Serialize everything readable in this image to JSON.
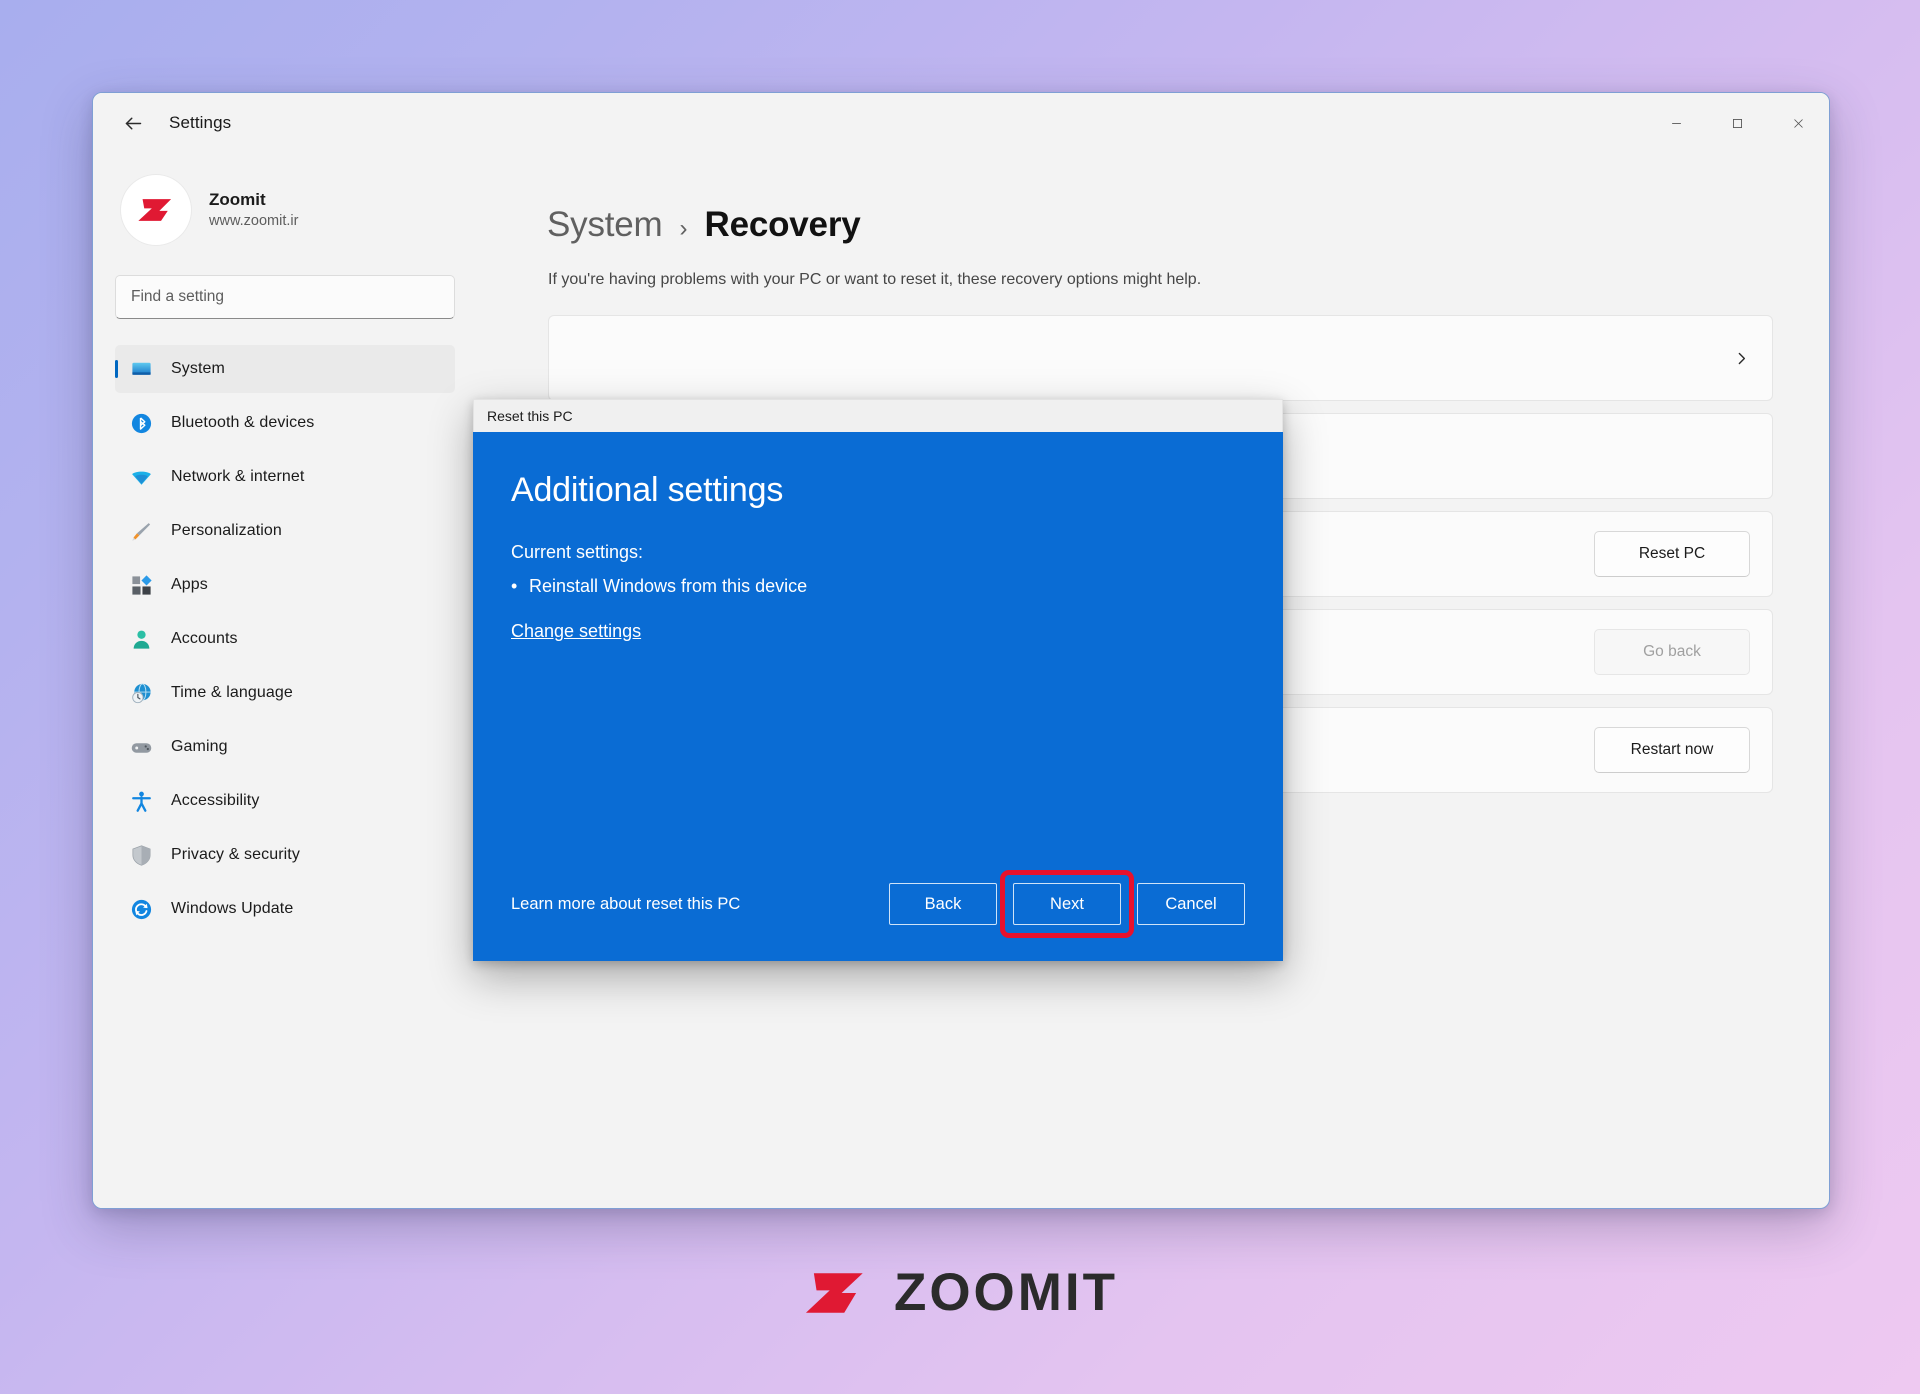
{
  "window": {
    "title": "Settings",
    "back_icon": "arrow-left-icon",
    "controls": {
      "minimize": "minimize-icon",
      "maximize": "maximize-icon",
      "close": "close-icon"
    }
  },
  "sidebar": {
    "profile": {
      "name": "Zoomit",
      "url": "www.zoomit.ir",
      "avatar_icon": "zoomit-logo-avatar"
    },
    "search": {
      "placeholder": "Find a setting",
      "value": ""
    },
    "items": [
      {
        "label": "System",
        "icon": "monitor-icon",
        "active": true
      },
      {
        "label": "Bluetooth & devices",
        "icon": "bluetooth-icon",
        "active": false
      },
      {
        "label": "Network & internet",
        "icon": "wifi-icon",
        "active": false
      },
      {
        "label": "Personalization",
        "icon": "paintbrush-icon",
        "active": false
      },
      {
        "label": "Apps",
        "icon": "apps-icon",
        "active": false
      },
      {
        "label": "Accounts",
        "icon": "person-icon",
        "active": false
      },
      {
        "label": "Time & language",
        "icon": "clock-globe-icon",
        "active": false
      },
      {
        "label": "Gaming",
        "icon": "gamepad-icon",
        "active": false
      },
      {
        "label": "Accessibility",
        "icon": "accessibility-icon",
        "active": false
      },
      {
        "label": "Privacy & security",
        "icon": "shield-icon",
        "active": false
      },
      {
        "label": "Windows Update",
        "icon": "update-refresh-icon",
        "active": false
      }
    ]
  },
  "main": {
    "breadcrumb": {
      "parent": "System",
      "separator": "›",
      "current": "Recovery"
    },
    "subtitle": "If you're having problems with your PC or want to reset it, these recovery options might help.",
    "cards": [
      {
        "kind": "chevron",
        "chevron_icon": "chevron-right-icon"
      },
      {
        "kind": "empty"
      },
      {
        "kind": "button",
        "button_label": "Reset PC",
        "disabled": false
      },
      {
        "kind": "button",
        "button_label": "Go back",
        "disabled": true
      },
      {
        "kind": "button",
        "button_label": "Restart now",
        "disabled": false
      }
    ]
  },
  "dialog": {
    "titlebar": "Reset this PC",
    "heading": "Additional settings",
    "current_settings_label": "Current settings:",
    "bullet_marker": "•",
    "settings": [
      "Reinstall Windows from this device"
    ],
    "change_link": "Change settings",
    "learn_more": "Learn more about reset this PC",
    "buttons": {
      "back": "Back",
      "next": "Next",
      "cancel": "Cancel"
    },
    "highlight_color": "#e8112d",
    "accent_color": "#0a6cd4"
  },
  "watermark": {
    "text": "ZOOMIT",
    "mark_icon": "zoomit-z-logo",
    "mark_color": "#e01933"
  }
}
